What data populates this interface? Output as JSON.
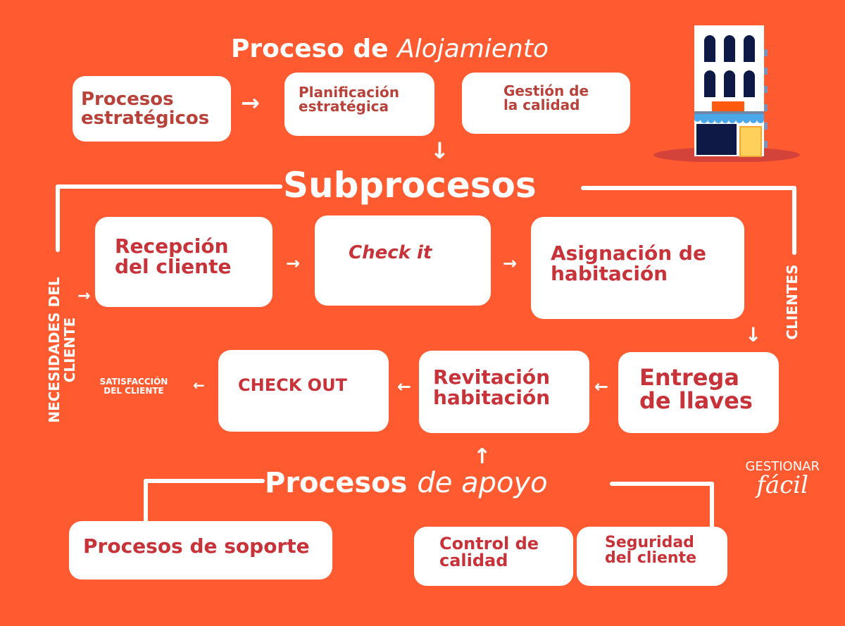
{
  "title": {
    "bold": "Proceso de",
    "italic": "Alojamiento"
  },
  "strategic": {
    "main": "Procesos\nestratégicos",
    "items": [
      "Planificación\nestratégica",
      "Gestión de\nla calidad"
    ]
  },
  "subprocesos": {
    "title": "Subprocesos",
    "row1": [
      "Recepción\ndel cliente",
      "Check it",
      "Asignación de\nhabitación"
    ],
    "row2": [
      "CHECK OUT",
      "Revitación\nhabitación",
      "Entrega\nde llaves"
    ],
    "left_label": "NECESIDADES DEL\nCLIENTE",
    "right_label": "CLIENTES",
    "output_label": "SATISFACCIÓN\nDEL CLIENTE"
  },
  "apoyo": {
    "title_bold": "Procesos",
    "title_italic": "de apoyo",
    "items": [
      "Procesos de soporte",
      "Control de\ncalidad",
      "Seguridad\ndel cliente"
    ]
  },
  "logo": {
    "top": "GESTIONAR",
    "bottom": "fácil"
  },
  "colors": {
    "background": "#FF5A30",
    "box_text": "#C8333A",
    "box": "#FFFFFF"
  }
}
